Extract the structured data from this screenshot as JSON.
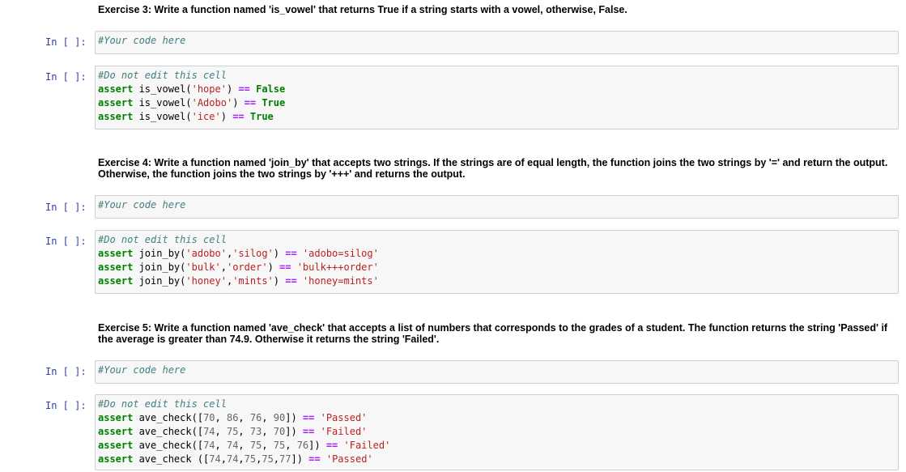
{
  "exercises": [
    {
      "title": "Exercise 3: Write a function named 'is_vowel' that returns True if a string starts with a vowel, otherwise, False.",
      "prompt_code": "In [ ]:",
      "your_code_comment": "#Your code here",
      "prompt_test": "In [ ]:",
      "test_comment": "#Do not edit this cell",
      "tests": [
        [
          "assert",
          " is_vowel(",
          "'hope'",
          ") ",
          "==",
          " ",
          "False"
        ],
        [
          "assert",
          " is_vowel(",
          "'Adobo'",
          ") ",
          "==",
          " ",
          "True"
        ],
        [
          "assert",
          " is_vowel(",
          "'ice'",
          ") ",
          "==",
          " ",
          "True"
        ]
      ]
    },
    {
      "title": "Exercise 4: Write a function named 'join_by' that accepts two strings. If the strings are of equal length, the function joins the two strings by '=' and return the output. Otherwise, the function joins the two strings by '+++' and returns the output.",
      "prompt_code": "In [ ]:",
      "your_code_comment": "#Your code here",
      "prompt_test": "In [ ]:",
      "test_comment": "#Do not edit this cell",
      "tests": [
        [
          "assert join_by(",
          "'adobo'",
          ",",
          "'silog'",
          ") ",
          "==",
          " ",
          "'adobo=silog'"
        ],
        [
          "assert join_by(",
          "'bulk'",
          ",",
          "'order'",
          ") ",
          "==",
          " ",
          "'bulk+++order'"
        ],
        [
          "assert join_by(",
          "'honey'",
          ",",
          "'mints'",
          ") ",
          "==",
          " ",
          "'honey=mints'"
        ]
      ]
    },
    {
      "title": "Exercise 5: Write a function named 'ave_check' that accepts a list of numbers that corresponds to the grades of a student. The function returns the string 'Passed' if the average is greater than 74.9. Otherwise it returns the string 'Failed'.",
      "prompt_code": "In [ ]:",
      "your_code_comment": "#Your code here",
      "prompt_test": "In [ ]:",
      "test_comment": "#Do not edit this cell",
      "tests": [
        [
          "assert ave_check([",
          "70",
          ", ",
          "86",
          ", ",
          "76",
          ", ",
          "90",
          "]) ",
          "==",
          " ",
          "'Passed'"
        ],
        [
          "assert ave_check([",
          "74",
          ", ",
          "75",
          ", ",
          "73",
          ", ",
          "70",
          "]) ",
          "==",
          " ",
          "'Failed'"
        ],
        [
          "assert ave_check([",
          "74",
          ", ",
          "74",
          ", ",
          "75",
          ", ",
          "75",
          ", ",
          "76",
          "]) ",
          "==",
          " ",
          "'Failed'"
        ],
        [
          "assert ave_check ([",
          "74",
          ",",
          "74",
          ",",
          "75",
          ",",
          "75",
          ",",
          "77",
          "]) ",
          "==",
          " ",
          "'Passed'"
        ]
      ]
    }
  ]
}
